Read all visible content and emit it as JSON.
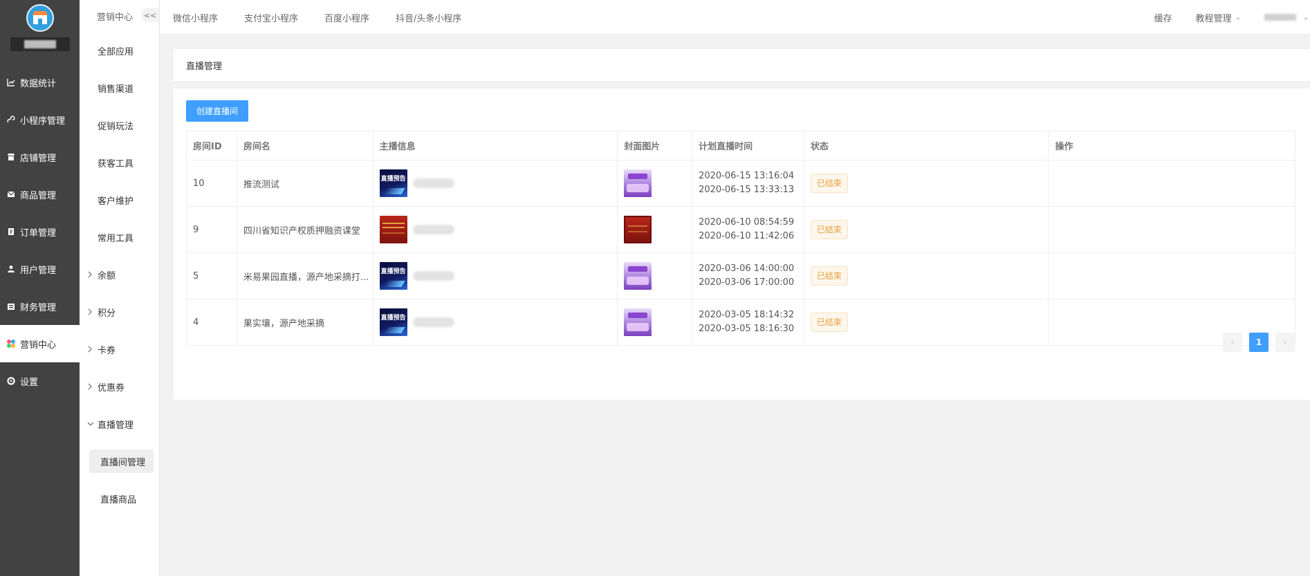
{
  "sidebar": {
    "items": [
      {
        "label": "数据统计",
        "icon": "chart-icon",
        "active": false
      },
      {
        "label": "小程序管理",
        "icon": "link-icon",
        "active": false
      },
      {
        "label": "店铺管理",
        "icon": "store-icon",
        "active": false
      },
      {
        "label": "商品管理",
        "icon": "mail-icon",
        "active": false
      },
      {
        "label": "订单管理",
        "icon": "clipboard-icon",
        "active": false
      },
      {
        "label": "用户管理",
        "icon": "user-icon",
        "active": false
      },
      {
        "label": "财务管理",
        "icon": "wallet-icon",
        "active": false
      },
      {
        "label": "营销中心",
        "icon": "marketing-icon",
        "active": true
      },
      {
        "label": "设置",
        "icon": "gear-icon",
        "active": false
      }
    ]
  },
  "subnav": {
    "title": "营销中心",
    "collapse_label": "<<",
    "items": [
      {
        "label": "全部应用"
      },
      {
        "label": "销售渠道"
      },
      {
        "label": "促销玩法"
      },
      {
        "label": "获客工具"
      },
      {
        "label": "客户维护"
      },
      {
        "label": "常用工具"
      }
    ],
    "groups": [
      {
        "label": "余额",
        "expanded": false
      },
      {
        "label": "积分",
        "expanded": false
      },
      {
        "label": "卡券",
        "expanded": false
      },
      {
        "label": "优惠券",
        "expanded": false
      },
      {
        "label": "直播管理",
        "expanded": true
      }
    ],
    "children": [
      {
        "label": "直播间管理",
        "active": true
      },
      {
        "label": "直播商品",
        "active": false
      }
    ]
  },
  "topbar": {
    "tabs": [
      "微信小程序",
      "支付宝小程序",
      "百度小程序",
      "抖音/头条小程序"
    ],
    "cache_label": "缓存",
    "tutorial_label": "教程管理"
  },
  "breadcrumb": "直播管理",
  "create_button": "创建直播间",
  "table": {
    "headers": [
      "房间ID",
      "房间名",
      "主播信息",
      "封面图片",
      "计划直播时间",
      "状态",
      "操作"
    ],
    "rows": [
      {
        "id": "10",
        "name": "推流测试",
        "anchor_thumb": "dark",
        "cover": "purple",
        "start": "2020-06-15 13:16:04",
        "end": "2020-06-15 13:33:13",
        "status": "已结束"
      },
      {
        "id": "9",
        "name": "四川省知识产权质押融资课堂",
        "anchor_thumb": "red",
        "cover": "red",
        "start": "2020-06-10 08:54:59",
        "end": "2020-06-10 11:42:06",
        "status": "已结束"
      },
      {
        "id": "5",
        "name": "米易果园直播，源产地采摘打...",
        "anchor_thumb": "dark",
        "cover": "purple",
        "start": "2020-03-06 14:00:00",
        "end": "2020-03-06 17:00:00",
        "status": "已结束"
      },
      {
        "id": "4",
        "name": "果实壤，源产地采摘",
        "anchor_thumb": "dark",
        "cover": "purple",
        "start": "2020-03-05 18:14:32",
        "end": "2020-03-05 18:16:30",
        "status": "已结束"
      }
    ]
  },
  "pagination": {
    "prev": "‹",
    "current": "1",
    "next": "›"
  },
  "colors": {
    "primary": "#409eff",
    "sidebar_bg": "#424242",
    "status_text": "#e6a23c"
  }
}
